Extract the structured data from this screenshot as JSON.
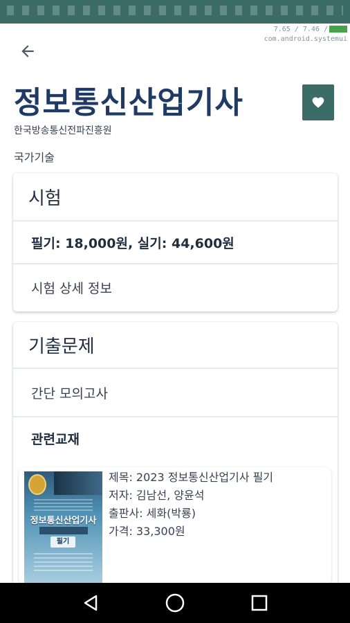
{
  "status_bar": {
    "color": "#3b6c66"
  },
  "debug_overlay": {
    "line1": "7.65 / 7.46 /",
    "line2": "com.android.systemui"
  },
  "header": {
    "back_icon": "arrow-left-icon",
    "title": "정보통신산업기사",
    "favorite_icon": "heart-icon",
    "organization": "한국방송통신전파진흥원",
    "category": "국가기술"
  },
  "exam_section": {
    "heading": "시험",
    "fee": "필기: 18,000원, 실기: 44,600원",
    "detail_link": "시험 상세 정보"
  },
  "past_section": {
    "heading": "기출문제",
    "mock_exam": "간단 모의고사",
    "related_books": "관련교재"
  },
  "book": {
    "cover_title": "정보통신산업기사",
    "cover_badge": "필기",
    "title": "제목: 2023 정보통신산업기사 필기",
    "author": "저자: 김남선, 양윤석",
    "publisher": "출판사: 세화(박룡)",
    "price": "가격: 33,300원"
  },
  "nav": {
    "back": "nav-back-icon",
    "home": "nav-home-icon",
    "recents": "nav-recents-icon"
  },
  "colors": {
    "accent": "#3b6c66",
    "title": "#1f3a64"
  }
}
